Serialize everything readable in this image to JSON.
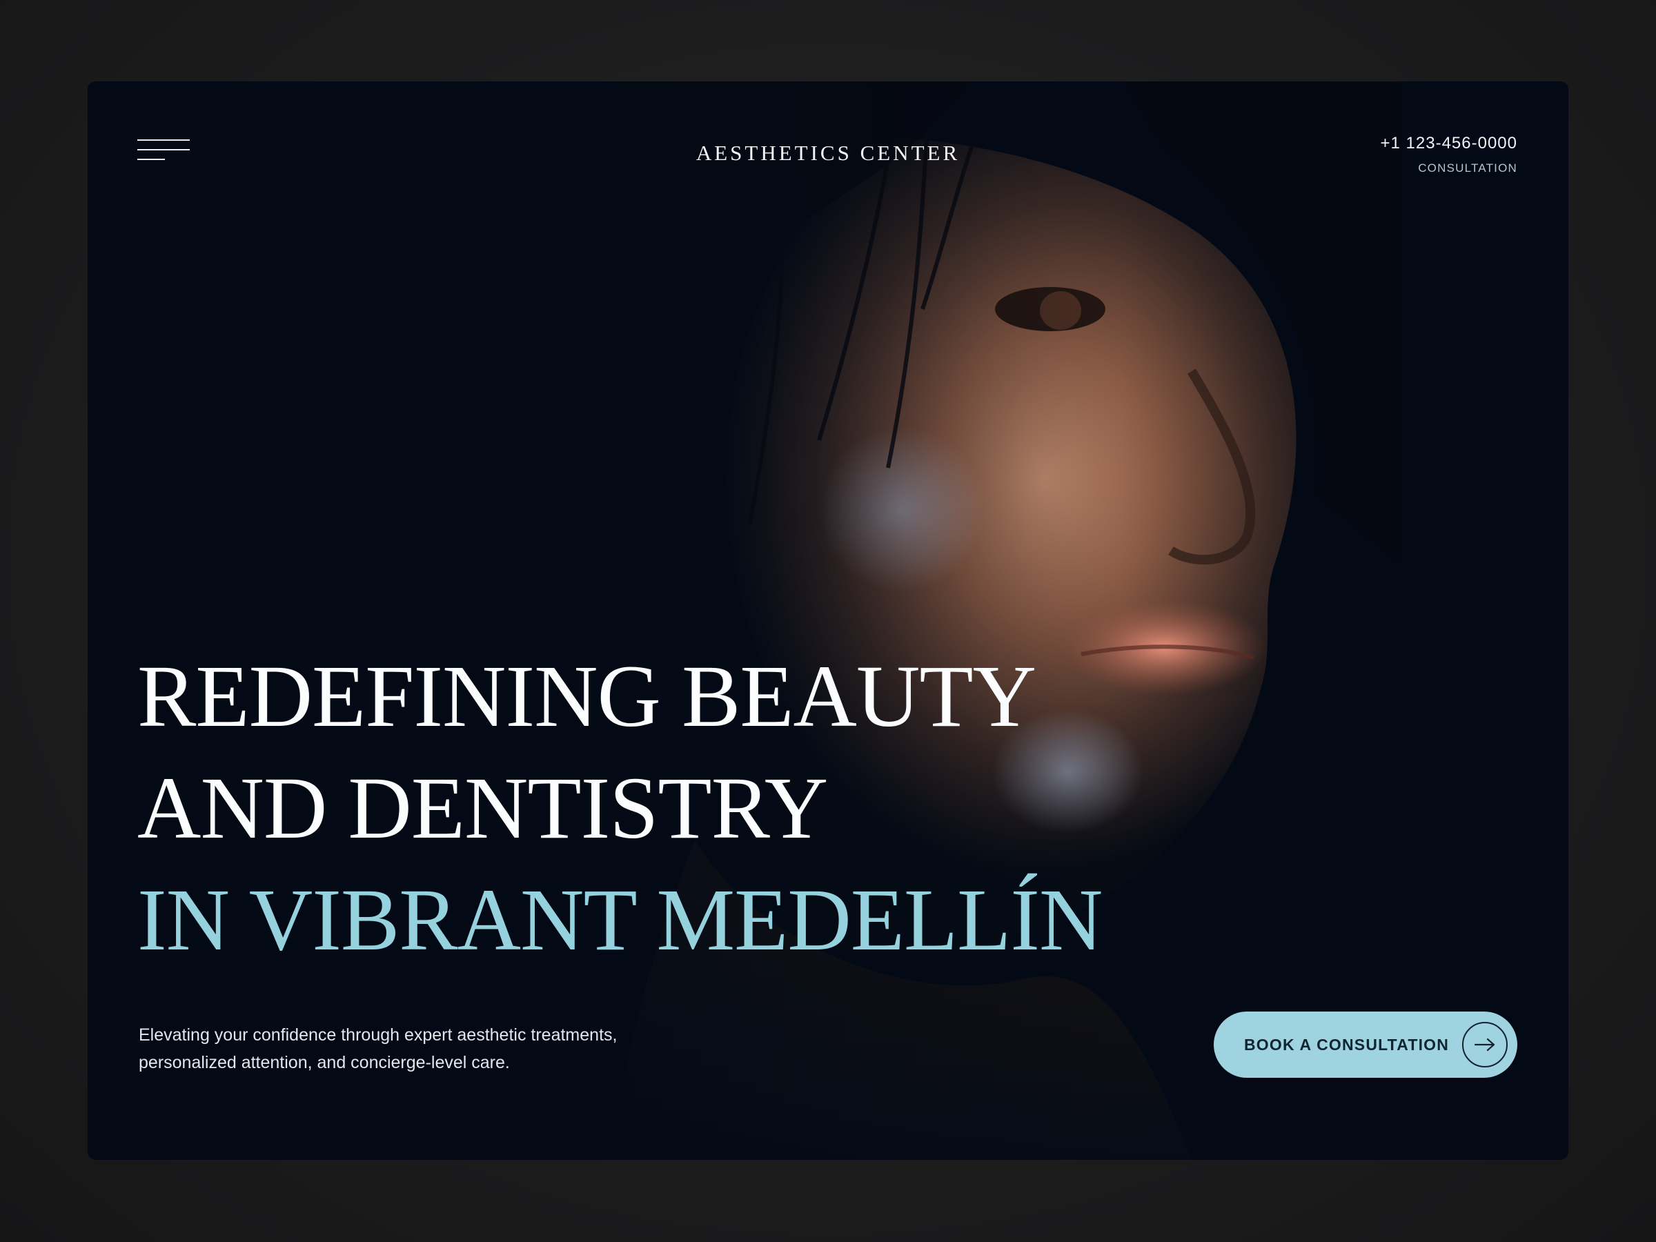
{
  "header": {
    "brand": "AESTHETICS CENTER",
    "phone": "+1 123-456-0000",
    "consultation_link": "CONSULTATION"
  },
  "hero": {
    "headline_line1": "REDEFINING BEAUTY",
    "headline_line2": "AND DENTISTRY",
    "headline_line3": "IN VIBRANT MEDELLÍN",
    "description_line1": "Elevating your confidence through expert aesthetic treatments,",
    "description_line2": "personalized attention, and concierge-level care.",
    "cta_label": "BOOK A CONSULTATION"
  },
  "icons": {
    "menu": "hamburger-menu-icon",
    "cta": "arrow-right-icon"
  },
  "colors": {
    "background": "#030a16",
    "accent": "#96d2de",
    "button": "#9ed3df",
    "text": "#fbfcfd"
  }
}
